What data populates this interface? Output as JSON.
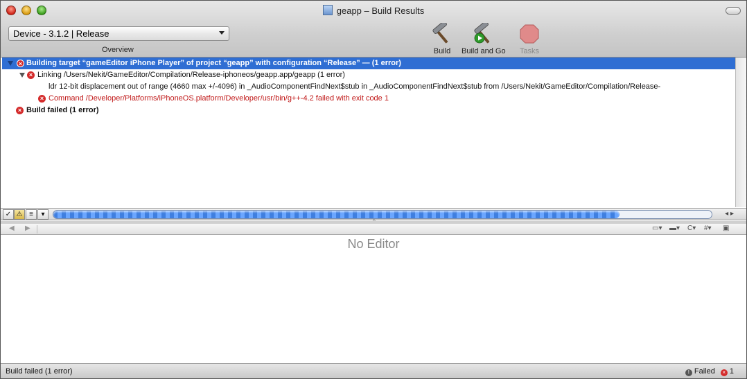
{
  "window": {
    "title": "geapp – Build Results"
  },
  "toolbar": {
    "device_select_value": "Device - 3.1.2 | Release",
    "overview_label": "Overview",
    "build_label": "Build",
    "build_and_go_label": "Build and Go",
    "tasks_label": "Tasks"
  },
  "results": {
    "rows": [
      {
        "text": "Building target “gameEditor iPhone Player” of project “geapp” with configuration “Release” — (1 error)"
      },
      {
        "text": "Linking /Users/Nekit/GameEditor/Compilation/Release-iphoneos/geapp.app/geapp (1 error)"
      },
      {
        "text": "ldr 12-bit displacement out of range (4660 max +/-4096) in _AudioComponentFindNext$stub in _AudioComponentFindNext$stub from /Users/Nekit/GameEditor/Compilation/Release-"
      },
      {
        "text": "Command /Developer/Platforms/iPhoneOS.platform/Developer/usr/bin/g++-4.2 failed with exit code 1"
      },
      {
        "text": "Build failed (1 error)"
      }
    ]
  },
  "editor": {
    "placeholder": "No Editor"
  },
  "statusbar": {
    "left_text": "Build failed (1 error)",
    "result_text": "Failed",
    "error_count": "1"
  },
  "colors": {
    "selection": "#2f6ed3",
    "error": "#d42b2b",
    "error_text": "#c01818"
  },
  "progress": {
    "fraction": 0.86
  }
}
